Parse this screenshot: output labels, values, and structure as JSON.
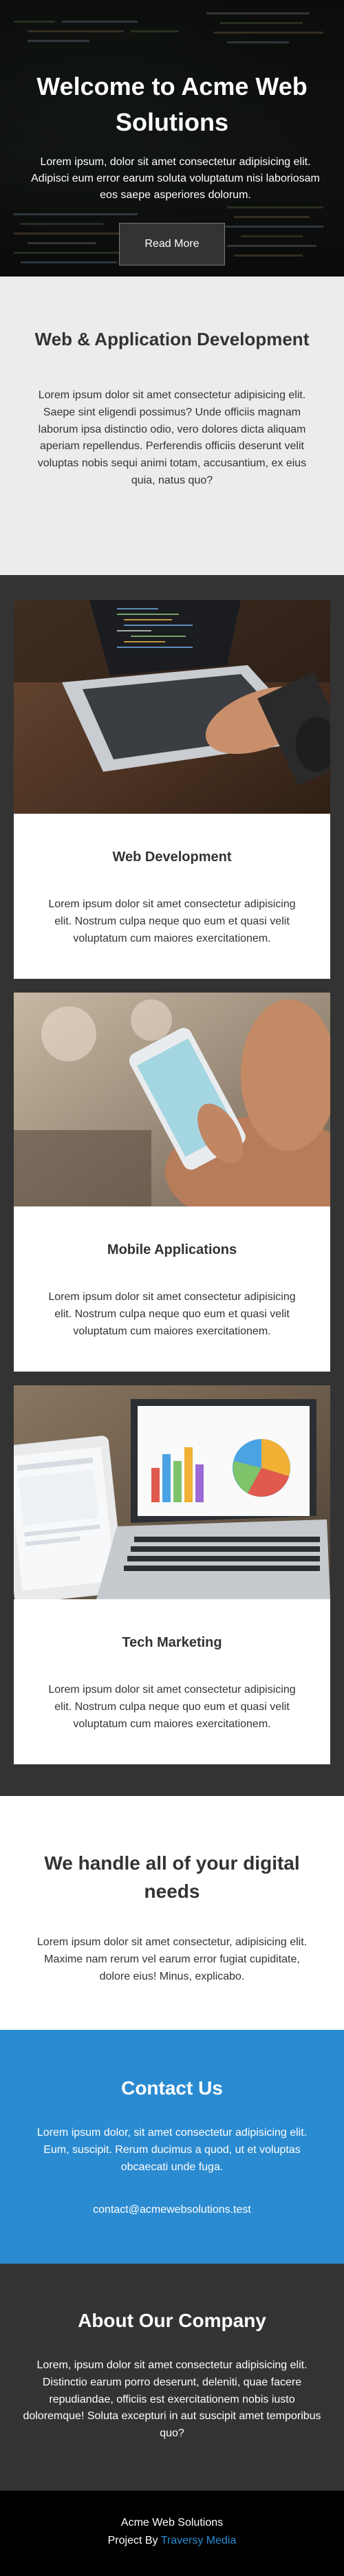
{
  "hero": {
    "title": "Welcome to Acme Web Solutions",
    "text": "Lorem ipsum, dolor sit amet consectetur adipisicing elit. Adipisci eum error earum soluta voluptatum nisi laboriosam eos saepe asperiores dolorum.",
    "button_label": "Read More"
  },
  "intro": {
    "title": "Web & Application Development",
    "text": "Lorem ipsum dolor sit amet consectetur adipisicing elit. Saepe sint eligendi possimus? Unde officiis magnam laborum ipsa distinctio odio, vero dolores dicta aliquam aperiam repellendus. Perferendis officiis deserunt velit voluptas nobis sequi animi totam, accusantium, ex eius quia, natus quo?"
  },
  "cards": [
    {
      "title": "Web Development",
      "text": "Lorem ipsum dolor sit amet consectetur adipisicing elit. Nostrum culpa neque quo eum et quasi velit voluptatum cum maiores exercitationem.",
      "image_icon": "laptop-coding-photo"
    },
    {
      "title": "Mobile Applications",
      "text": "Lorem ipsum dolor sit amet consectetur adipisicing elit. Nostrum culpa neque quo eum et quasi velit voluptatum cum maiores exercitationem.",
      "image_icon": "smartphone-photo"
    },
    {
      "title": "Tech Marketing",
      "text": "Lorem ipsum dolor sit amet consectetur adipisicing elit. Nostrum culpa neque quo eum et quasi velit voluptatum cum maiores exercitationem.",
      "image_icon": "laptop-charts-photo"
    }
  ],
  "digital": {
    "title": "We handle all of your digital needs",
    "text": "Lorem ipsum dolor sit amet consectetur, adipisicing elit. Maxime nam rerum vel earum error fugiat cupiditate, dolore eius! Minus, explicabo."
  },
  "contact": {
    "title": "Contact Us",
    "text": "Lorem ipsum dolor, sit amet consectetur adipisicing elit. Eum, suscipit. Rerum ducimus a quod, ut et voluptas obcaecati unde fuga.",
    "email": "contact@acmewebsolutions.test"
  },
  "about": {
    "title": "About Our Company",
    "text": "Lorem, ipsum dolor sit amet consectetur adipisicing elit. Distinctio earum porro deserunt, deleniti, quae facere repudiandae, officiis est exercitationem nobis iusto doloremque! Soluta excepturi in aut suscipit amet temporibus quo?"
  },
  "footer": {
    "company": "Acme Web Solutions",
    "credit_prefix": "Project By",
    "credit_link": "Traversy Media"
  },
  "colors": {
    "accent_blue": "#2b8bd1",
    "dark": "#333333",
    "light_gray": "#ececec",
    "footer_black": "#000000"
  }
}
